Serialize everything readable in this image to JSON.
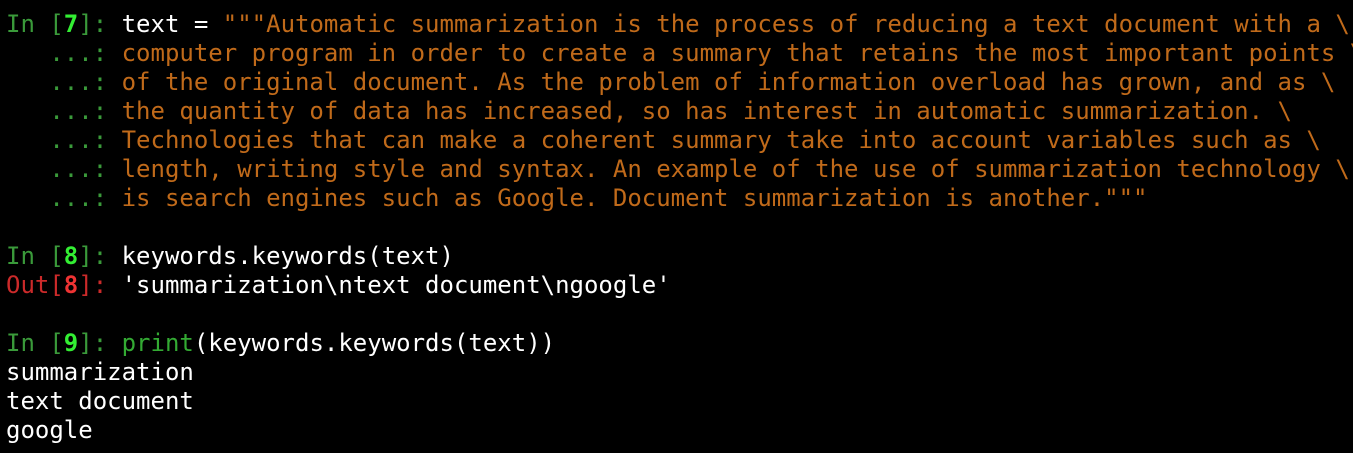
{
  "colors": {
    "background": "#000000",
    "prompt_in": "#3a9a3a",
    "prompt_out": "#cc2a2a",
    "string": "#c06a1a",
    "builtin": "#33aa33",
    "text": "#ffffff"
  },
  "cells": {
    "c7": {
      "in_label": "In [",
      "num": "7",
      "close": "]: ",
      "code_prefix": "text = ",
      "lines": [
        "\"\"\"Automatic summarization is the process of reducing a text document with a \\",
        "computer program in order to create a summary that retains the most important points \\",
        "of the original document. As the problem of information overload has grown, and as \\",
        "the quantity of data has increased, so has interest in automatic summarization. \\",
        "Technologies that can make a coherent summary take into account variables such as \\",
        "length, writing style and syntax. An example of the use of summarization technology \\",
        "is search engines such as Google. Document summarization is another.\"\"\""
      ],
      "continuation": "   ...: "
    },
    "c8": {
      "in_label": "In [",
      "num": "8",
      "close": "]: ",
      "code": "keywords.keywords(text)",
      "out_label": "Out[",
      "out_num": "8",
      "out_close": "]: ",
      "out_value": "'summarization\\ntext document\\ngoogle'"
    },
    "c9": {
      "in_label": "In [",
      "num": "9",
      "close": "]: ",
      "builtin": "print",
      "code": "(keywords.keywords(text))",
      "output": [
        "summarization",
        "text document",
        "google"
      ]
    }
  }
}
